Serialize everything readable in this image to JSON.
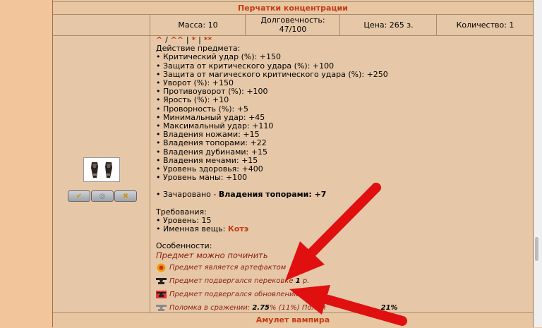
{
  "item": {
    "title": "Перчатки концентрации",
    "mass": "Масса: 10",
    "durability_label": "Долговечность:",
    "durability_value": "47/100",
    "price": "Цена: 265 з.",
    "quantity": "Количество: 1"
  },
  "nav_links": [
    "^",
    "/",
    "^^",
    "|",
    "*",
    "|",
    "**"
  ],
  "effects_title": "Действие предмета:",
  "effects": [
    "• Критический удар (%): +150",
    "• Защита от критического удара (%): +100",
    "• Защита от магического критического удара (%): +250",
    "• Уворот (%): +150",
    "• Противоуворот (%): +100",
    "• Ярость (%): +10",
    "• Проворность (%): +5",
    "• Минимальный удар: +45",
    "• Максимальный удар: +110",
    "• Владения ножами: +15",
    "• Владения топорами: +22",
    "• Владения дубинами: +15",
    "• Владения мечами: +15",
    "• Уровень здоровья: +400",
    "• Уровень маны: +100"
  ],
  "enchant": {
    "prefix": "• Зачаровано - ",
    "skill": "Владения топорами",
    "value": ": +7"
  },
  "requirements": {
    "title": "Требования:",
    "level": "• Уровень: 15",
    "named_prefix": "• Именная вещь: ",
    "named_owner": "Котэ"
  },
  "features": {
    "title": "Особенности:",
    "repair": "Предмет можно починить",
    "artifact": "Предмет является артефактом",
    "forged_prefix": "Предмет подвергался перековке ",
    "forged_count": "1",
    "forged_suffix": " р.",
    "updated": "Предмет подвергался обновлению",
    "damage_prefix": "Поломка в сражении: ",
    "damage_value": "2.75",
    "damage_mid": "% (11%) Полом",
    "damage_tail": "21%"
  },
  "buttons": {
    "equip": "✔",
    "view": "👁",
    "drop": "✖"
  },
  "next_item": "Амулет вампира",
  "colors": {
    "accent": "#c33b15",
    "panel": "#e6c8a8",
    "page_bg": "#f3c59a",
    "arrow": "#e01010"
  }
}
